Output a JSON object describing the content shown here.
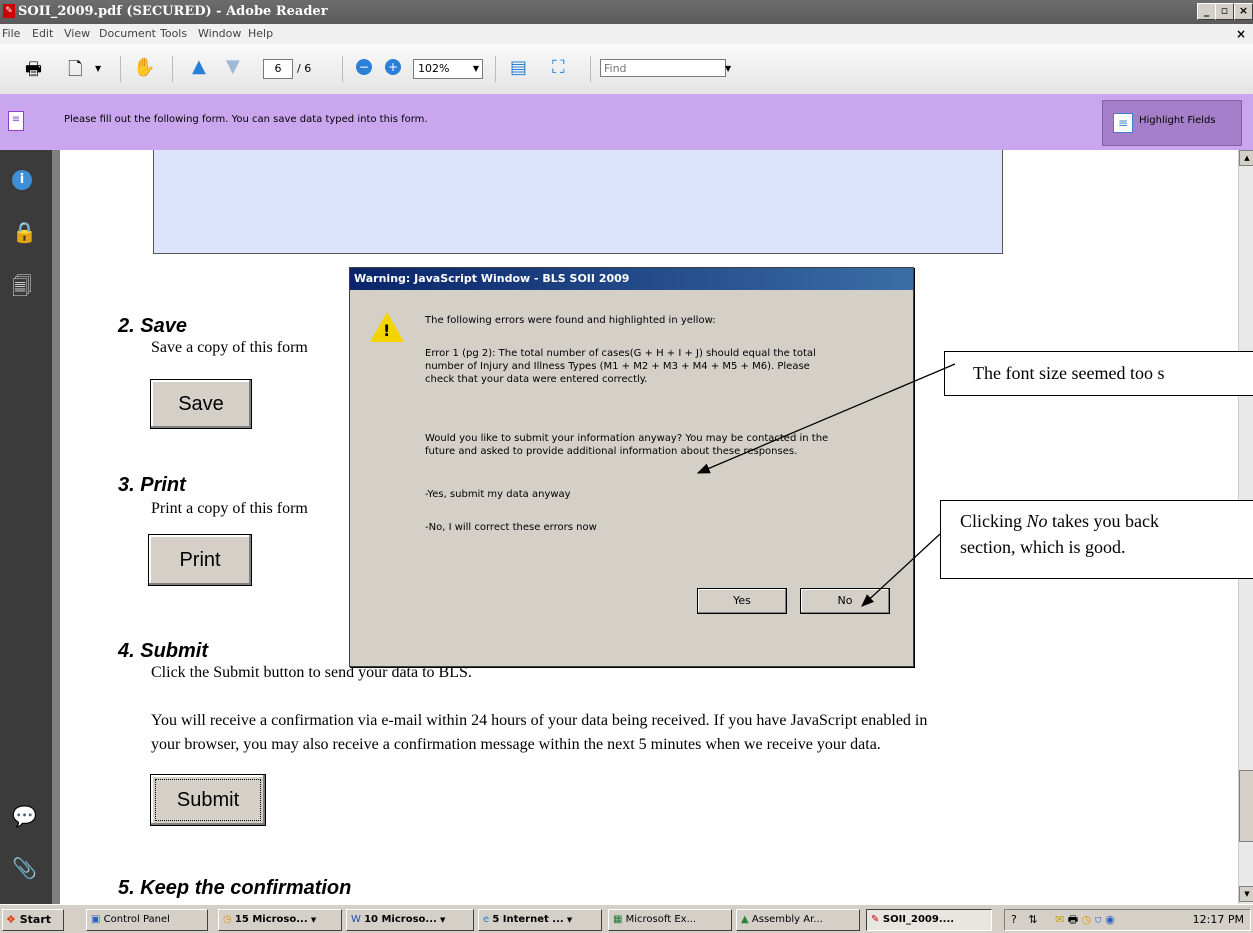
{
  "window": {
    "title": "SOII_2009.pdf (SECURED) - Adobe Reader"
  },
  "menu": [
    "File",
    "Edit",
    "View",
    "Document",
    "Tools",
    "Window",
    "Help"
  ],
  "toolbar": {
    "page_current": "6",
    "page_total": "/ 6",
    "zoom": "102%",
    "find_placeholder": "Find"
  },
  "formbar": {
    "message": "Please fill out the following form. You can save data typed into this form.",
    "highlight_label": "Highlight Fields"
  },
  "document": {
    "sections": [
      {
        "heading": "2.  Save",
        "text": "Save a copy of this form",
        "button": "Save"
      },
      {
        "heading": "3.  Print",
        "text": "Print a copy of this form",
        "button": "Print"
      },
      {
        "heading": "4.  Submit",
        "text": "Click the Submit button to send your data to BLS.",
        "button": "Submit"
      },
      {
        "heading": "5.  Keep the confirmation"
      }
    ],
    "submit_note_1": "You will receive a confirmation via e-mail within 24 hours of your data being received.  If you have JavaScript enabled in",
    "submit_note_2": "your browser, you may also receive a confirmation message within the next 5 minutes when we receive your data."
  },
  "dialog": {
    "title": "Warning: JavaScript Window - BLS SOII 2009",
    "line1": "The following errors were found and highlighted in yellow:",
    "error_1": "Error 1 (pg 2): The total number of cases(G + H + I + J) should equal the total",
    "error_2": "number of Injury and Illness Types (M1 + M2 + M3 + M4 + M5 + M6). Please",
    "error_3": "check that your data were entered correctly.",
    "question_1": "Would you like to submit your information anyway? You may be contacted in the",
    "question_2": "future and asked to provide additional information about these responses.",
    "opt_yes": "-Yes, submit my data anyway",
    "opt_no": "-No, I will correct these errors now",
    "yes_label": "Yes",
    "no_label": "No"
  },
  "callouts": {
    "font": "The font size seemed too s",
    "no_1a": "Clicking ",
    "no_1b": "No",
    "no_1c": " takes you back",
    "no_2": "section, which is good."
  },
  "taskbar": {
    "start": "Start",
    "items": [
      "Control Panel",
      "15 Microso...",
      "10 Microso...",
      "5 Internet ...",
      "Microsoft Ex...",
      "Assembly Ar...",
      "SOII_2009...."
    ],
    "time": "12:17 PM"
  }
}
